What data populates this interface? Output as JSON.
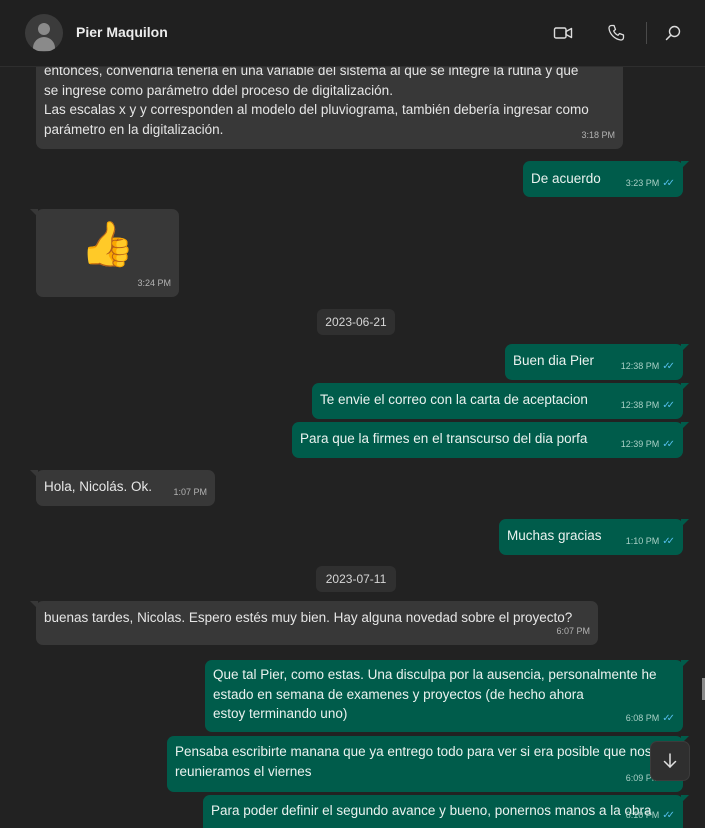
{
  "header": {
    "contact_name": "Pier Maquilon",
    "icons": [
      "avatar",
      "video-call-icon",
      "voice-call-icon",
      "search-icon"
    ]
  },
  "colors": {
    "incoming_bubble": "#383838",
    "outgoing_bubble": "#005c4b",
    "read_ticks": "#53bdeb",
    "chat_background": "#222222"
  },
  "messages": [
    {
      "dir": "in",
      "text": "entonces, convendría tenerla en una variable del sistema al que se integre la rutina y que\nse ingrese como parámetro ddel proceso de digitalización.\nLas escalas x y y corresponden al modelo del pluviograma, también debería ingresar como\nparámetro en la digitalización.",
      "time": "3:18 PM"
    },
    {
      "dir": "out",
      "text": "De acuerdo",
      "time": "3:23 PM"
    },
    {
      "dir": "in",
      "text": "👍",
      "time": "3:24 PM"
    },
    {
      "dir": "out",
      "text": "Buen dia Pier",
      "time": "12:38 PM"
    },
    {
      "dir": "out",
      "text": "Te envie el correo con la carta de aceptacion",
      "time": "12:38 PM"
    },
    {
      "dir": "out",
      "text": "Para que la firmes en el transcurso del dia porfa",
      "time": "12:39 PM"
    },
    {
      "dir": "in",
      "text": "Hola, Nicolás. Ok.",
      "time": "1:07 PM"
    },
    {
      "dir": "out",
      "text": "Muchas gracias",
      "time": "1:10 PM"
    },
    {
      "dir": "in",
      "text": "buenas tardes, Nicolas. Espero estés muy bien. Hay alguna novedad sobre el proyecto?",
      "time": "6:07 PM"
    },
    {
      "dir": "out",
      "text": "Que tal Pier, como estas. Una disculpa por la ausencia, personalmente he\nestado en semana de examenes y proyectos (de hecho ahora\nestoy terminando uno)",
      "time": "6:08 PM"
    },
    {
      "dir": "out",
      "text": "Pensaba escribirte manana que ya entrego todo para ver si era posible que nos\nreunieramos el viernes",
      "time": "6:09 PM"
    },
    {
      "dir": "out",
      "text": "Para poder definir el segundo avance y bueno, ponernos manos a la obra",
      "time": "6:10 PM"
    }
  ],
  "dates": [
    "2023-06-21",
    "2023-07-11"
  ]
}
